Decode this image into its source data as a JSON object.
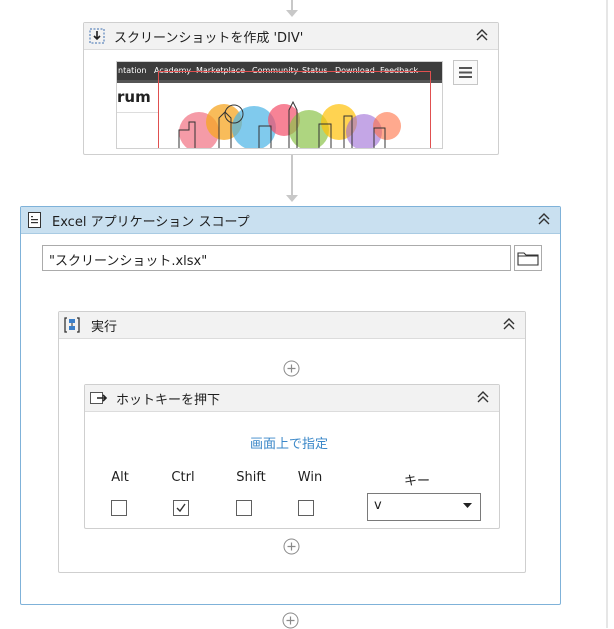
{
  "screenshot_activity": {
    "title": "スクリーンショットを作成 'DIV'",
    "preview": {
      "nav_items": [
        "ntation",
        "Academy",
        "Marketplace",
        "Community",
        "Status",
        "Download",
        "Feedback"
      ],
      "heading_fragment": "rum"
    }
  },
  "excel_scope": {
    "title": "Excel アプリケーション スコープ",
    "file_path_value": "\"スクリーンショット.xlsx\""
  },
  "sequence": {
    "title": "実行"
  },
  "hotkey": {
    "title": "ホットキーを押下",
    "indicate_link": "画面上で指定",
    "modifiers": [
      {
        "label": "Alt",
        "checked": false
      },
      {
        "label": "Ctrl",
        "checked": true
      },
      {
        "label": "Shift",
        "checked": false
      },
      {
        "label": "Win",
        "checked": false
      }
    ],
    "key_label": "キー",
    "key_value": "v"
  },
  "colors": {
    "selected_header": "#c9e0f0",
    "selected_border": "#7fb2d9",
    "link": "#3a87c8",
    "connector": "#c8c8c8"
  }
}
